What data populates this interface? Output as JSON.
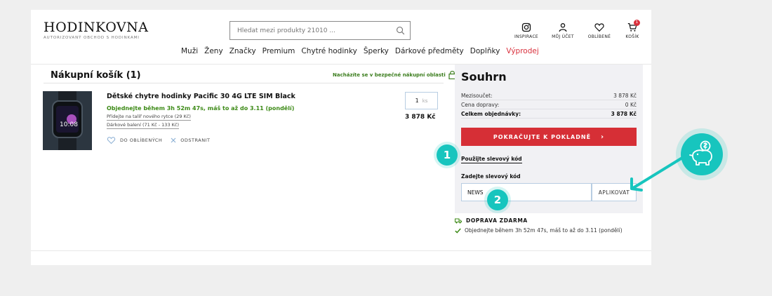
{
  "header": {
    "logo": "HODINKOVNA",
    "logo_tagline": "AUTORIZOVANÝ OBCHOD S HODINKAMI",
    "search_placeholder": "Hledat mezi produkty 21010 ...",
    "icons": [
      {
        "label": "INSPIRACE",
        "icon": "instagram-icon"
      },
      {
        "label": "MŮJ ÚČET",
        "icon": "user-icon"
      },
      {
        "label": "OBLÍBENÉ",
        "icon": "heart-icon"
      },
      {
        "label": "KOŠÍK",
        "icon": "cart-icon",
        "badge": "1"
      }
    ],
    "nav": [
      "Muži",
      "Ženy",
      "Značky",
      "Premium",
      "Chytré hodinky",
      "Šperky",
      "Dárkové předměty",
      "Doplňky",
      "Výprodej"
    ]
  },
  "cart": {
    "title": "Nákupní košík (1)",
    "secure_text": "Nacházíte se v bezpečné nákupní oblasti",
    "item": {
      "name": "Dětské chytre hodinky Pacific 30 4G LTE SIM Black",
      "delivery": "Objednejte během 3h 52m 47s, máš to až do 3.11 (pondělí)",
      "option1": "Přidejte na talíř nového rytce (29 Kč)",
      "option2": "Dárkové balení (71 Kč - 133 Kč)",
      "favorite_label": "DO OBLÍBENÝCH",
      "remove_label": "ODSTRANIT",
      "qty": "1",
      "qty_unit": "ks",
      "price": "3 878 Kč",
      "watch_time": "10:08"
    }
  },
  "summary": {
    "title": "Souhrn",
    "rows": [
      {
        "label": "Mezisoučet:",
        "value": "3 878 Kč"
      },
      {
        "label": "Cena dopravy:",
        "value": "0 Kč"
      },
      {
        "label": "Celkem objednávky:",
        "value": "3 878 Kč"
      }
    ],
    "checkout_button": "POKRAČUJTE K POKLADNĚ",
    "coupon_link": "Použijte slevový kód",
    "coupon_label": "Zadejte slevový kód",
    "coupon_value": "NEWS",
    "apply_button": "APLIKOVAT"
  },
  "shipping": {
    "title": "DOPRAVA ZDARMA",
    "detail": "Objednejte během 3h 52m 47s, máš to až do 3.11 (pondělí)"
  },
  "annotations": {
    "step1": "1",
    "step2": "2"
  },
  "colors": {
    "accent": "#d62f36",
    "teal": "#17c5be",
    "green": "#3c8a16"
  }
}
